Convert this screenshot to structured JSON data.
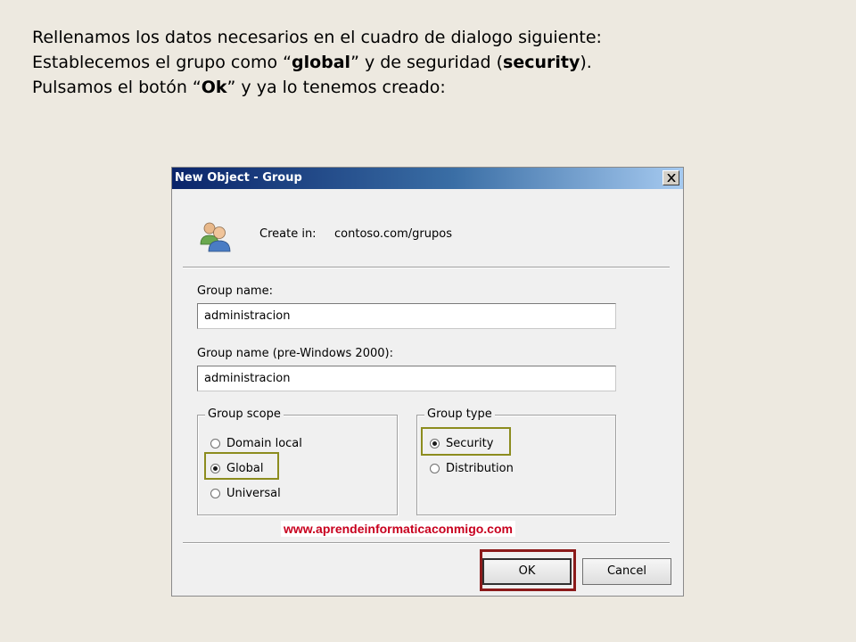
{
  "slide": {
    "line1": "Rellenamos los datos necesarios en el cuadro de dialogo siguiente:",
    "line2_pre": "Establecemos el grupo como “",
    "line2_global": "global",
    "line2_mid": "” y de seguridad (",
    "line2_security": "security",
    "line2_post": ").",
    "line3_pre": "Pulsamos el botón “",
    "line3_ok": "Ok",
    "line3_post": "” y ya lo tenemos creado:"
  },
  "dialog": {
    "title": "New Object - Group",
    "create_in_label": "Create in:",
    "create_in_value": "contoso.com/grupos",
    "group_name_label": "Group name:",
    "group_name_value": "administracion",
    "group_name_pre2000_label": "Group name (pre-Windows 2000):",
    "group_name_pre2000_value": "administracion",
    "group_scope": {
      "legend": "Group scope",
      "options": [
        "Domain local",
        "Global",
        "Universal"
      ],
      "selected": "Global"
    },
    "group_type": {
      "legend": "Group type",
      "options": [
        "Security",
        "Distribution"
      ],
      "selected": "Security"
    },
    "ok_label": "OK",
    "cancel_label": "Cancel"
  },
  "watermark": "www.aprendeinformaticaconmigo.com",
  "colors": {
    "highlight_olive": "#8c8c1e",
    "highlight_red": "#8b1a1a",
    "watermark_text": "#c8001e"
  }
}
